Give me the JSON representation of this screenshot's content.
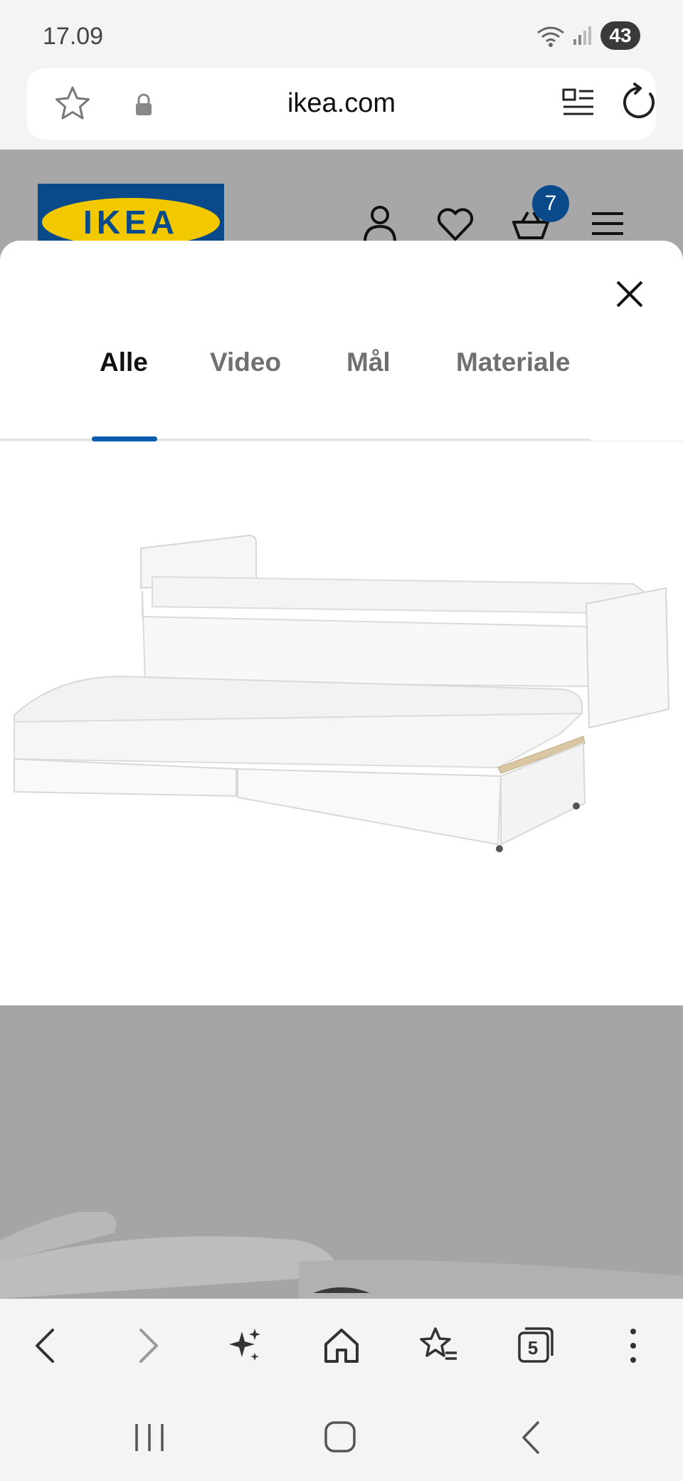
{
  "status_bar": {
    "time": "17.09",
    "battery": "43"
  },
  "url_bar": {
    "domain": "ikea.com"
  },
  "header": {
    "logo_text": "IKEA",
    "cart_count": "7",
    "brand_blue": "#0a4a8a",
    "brand_yellow": "#f2c800"
  },
  "modal": {
    "tabs": [
      {
        "label": "Alle",
        "active": true
      },
      {
        "label": "Video",
        "active": false
      },
      {
        "label": "Mål",
        "active": false
      },
      {
        "label": "Materiale",
        "active": false
      }
    ],
    "accent": "#0a5bb0"
  },
  "browser_toolbar": {
    "tabs_count": "5"
  }
}
